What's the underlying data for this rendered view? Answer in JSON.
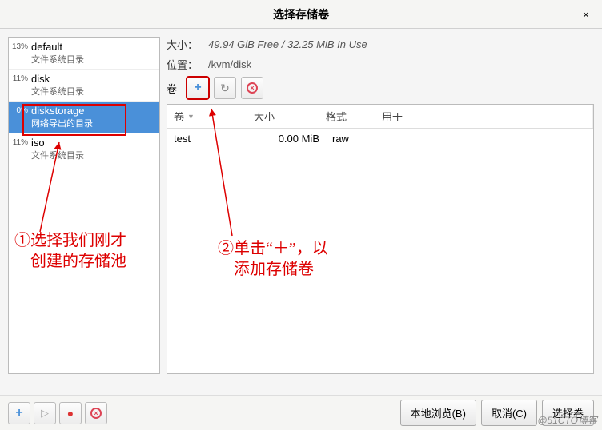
{
  "title": "选择存储卷",
  "left": {
    "pools": [
      {
        "pct": "13%",
        "name": "default",
        "desc": "文件系统目录"
      },
      {
        "pct": "11%",
        "name": "disk",
        "desc": "文件系统目录"
      },
      {
        "pct": "0%",
        "name": "diskstorage",
        "desc": "网络导出的目录",
        "selected": true
      },
      {
        "pct": "11%",
        "name": "iso",
        "desc": "文件系统目录"
      }
    ]
  },
  "right": {
    "size_label": "大小：",
    "size_value": "49.94 GiB Free / 32.25 MiB In Use",
    "loc_label": "位置：",
    "loc_value": "/kvm/disk",
    "vol_label": "卷",
    "table": {
      "cols": {
        "name": "卷",
        "size": "大小",
        "fmt": "格式",
        "use": "用于"
      },
      "rows": [
        {
          "name": "test",
          "size": "0.00 MiB",
          "fmt": "raw",
          "use": ""
        }
      ]
    }
  },
  "footer": {
    "browse": "本地浏览(B)",
    "cancel": "取消(C)",
    "choose": "选择卷"
  },
  "annot": {
    "a1": "①选择我们刚才\n　创建的存储池",
    "a2": "②单击“＋”，以\n　添加存储卷"
  },
  "watermark": "@51CTO博客"
}
